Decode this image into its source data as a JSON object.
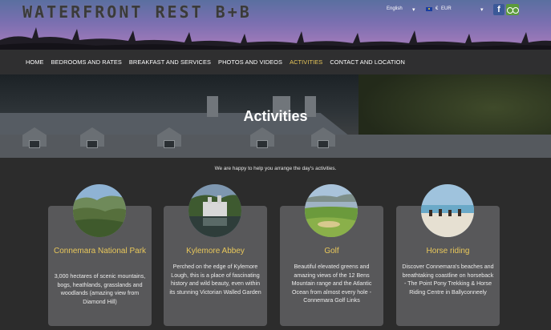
{
  "header": {
    "logo": "WATERFRONT REST B+B",
    "language": "English",
    "currency_symbol": "€",
    "currency": "EUR",
    "facebook_icon": "facebook-icon",
    "tripadvisor_icon": "tripadvisor-icon",
    "accent_color": "#e8c75a"
  },
  "nav": {
    "items": [
      {
        "label": "HOME"
      },
      {
        "label": "BEDROOMS AND RATES"
      },
      {
        "label": "BREAKFAST AND SERVICES"
      },
      {
        "label": "PHOTOS AND VIDEOS"
      },
      {
        "label": "ACTIVITIES"
      },
      {
        "label": "CONTACT AND LOCATION"
      }
    ],
    "active": "ACTIVITIES"
  },
  "banner": {
    "title": "Activities"
  },
  "intro": "We are happy to help you arrange the day's activities.",
  "cards": [
    {
      "title": "Connemara National Park",
      "description": "3,000 hectares of scenic mountains, bogs, heathlands, grasslands and woodlands (amazing view from Diamond Hill)"
    },
    {
      "title": "Kylemore Abbey",
      "description": "Perched on the edge of Kylemore Lough, this is a place of fascinating history and wild beauty, even within its stunning Victorian Walled Garden"
    },
    {
      "title": "Golf",
      "description": "Beautiful elevated greens and amazing views of the 12 Bens Mountain range and the Atlantic Ocean from almost every hole - Connemara Golf Links"
    },
    {
      "title": "Horse riding",
      "description": "Discover Connemara's beaches and breathtaking coastline on horseback - The Point Pony Trekking & Horse Riding Centre in Ballyconneely"
    }
  ]
}
